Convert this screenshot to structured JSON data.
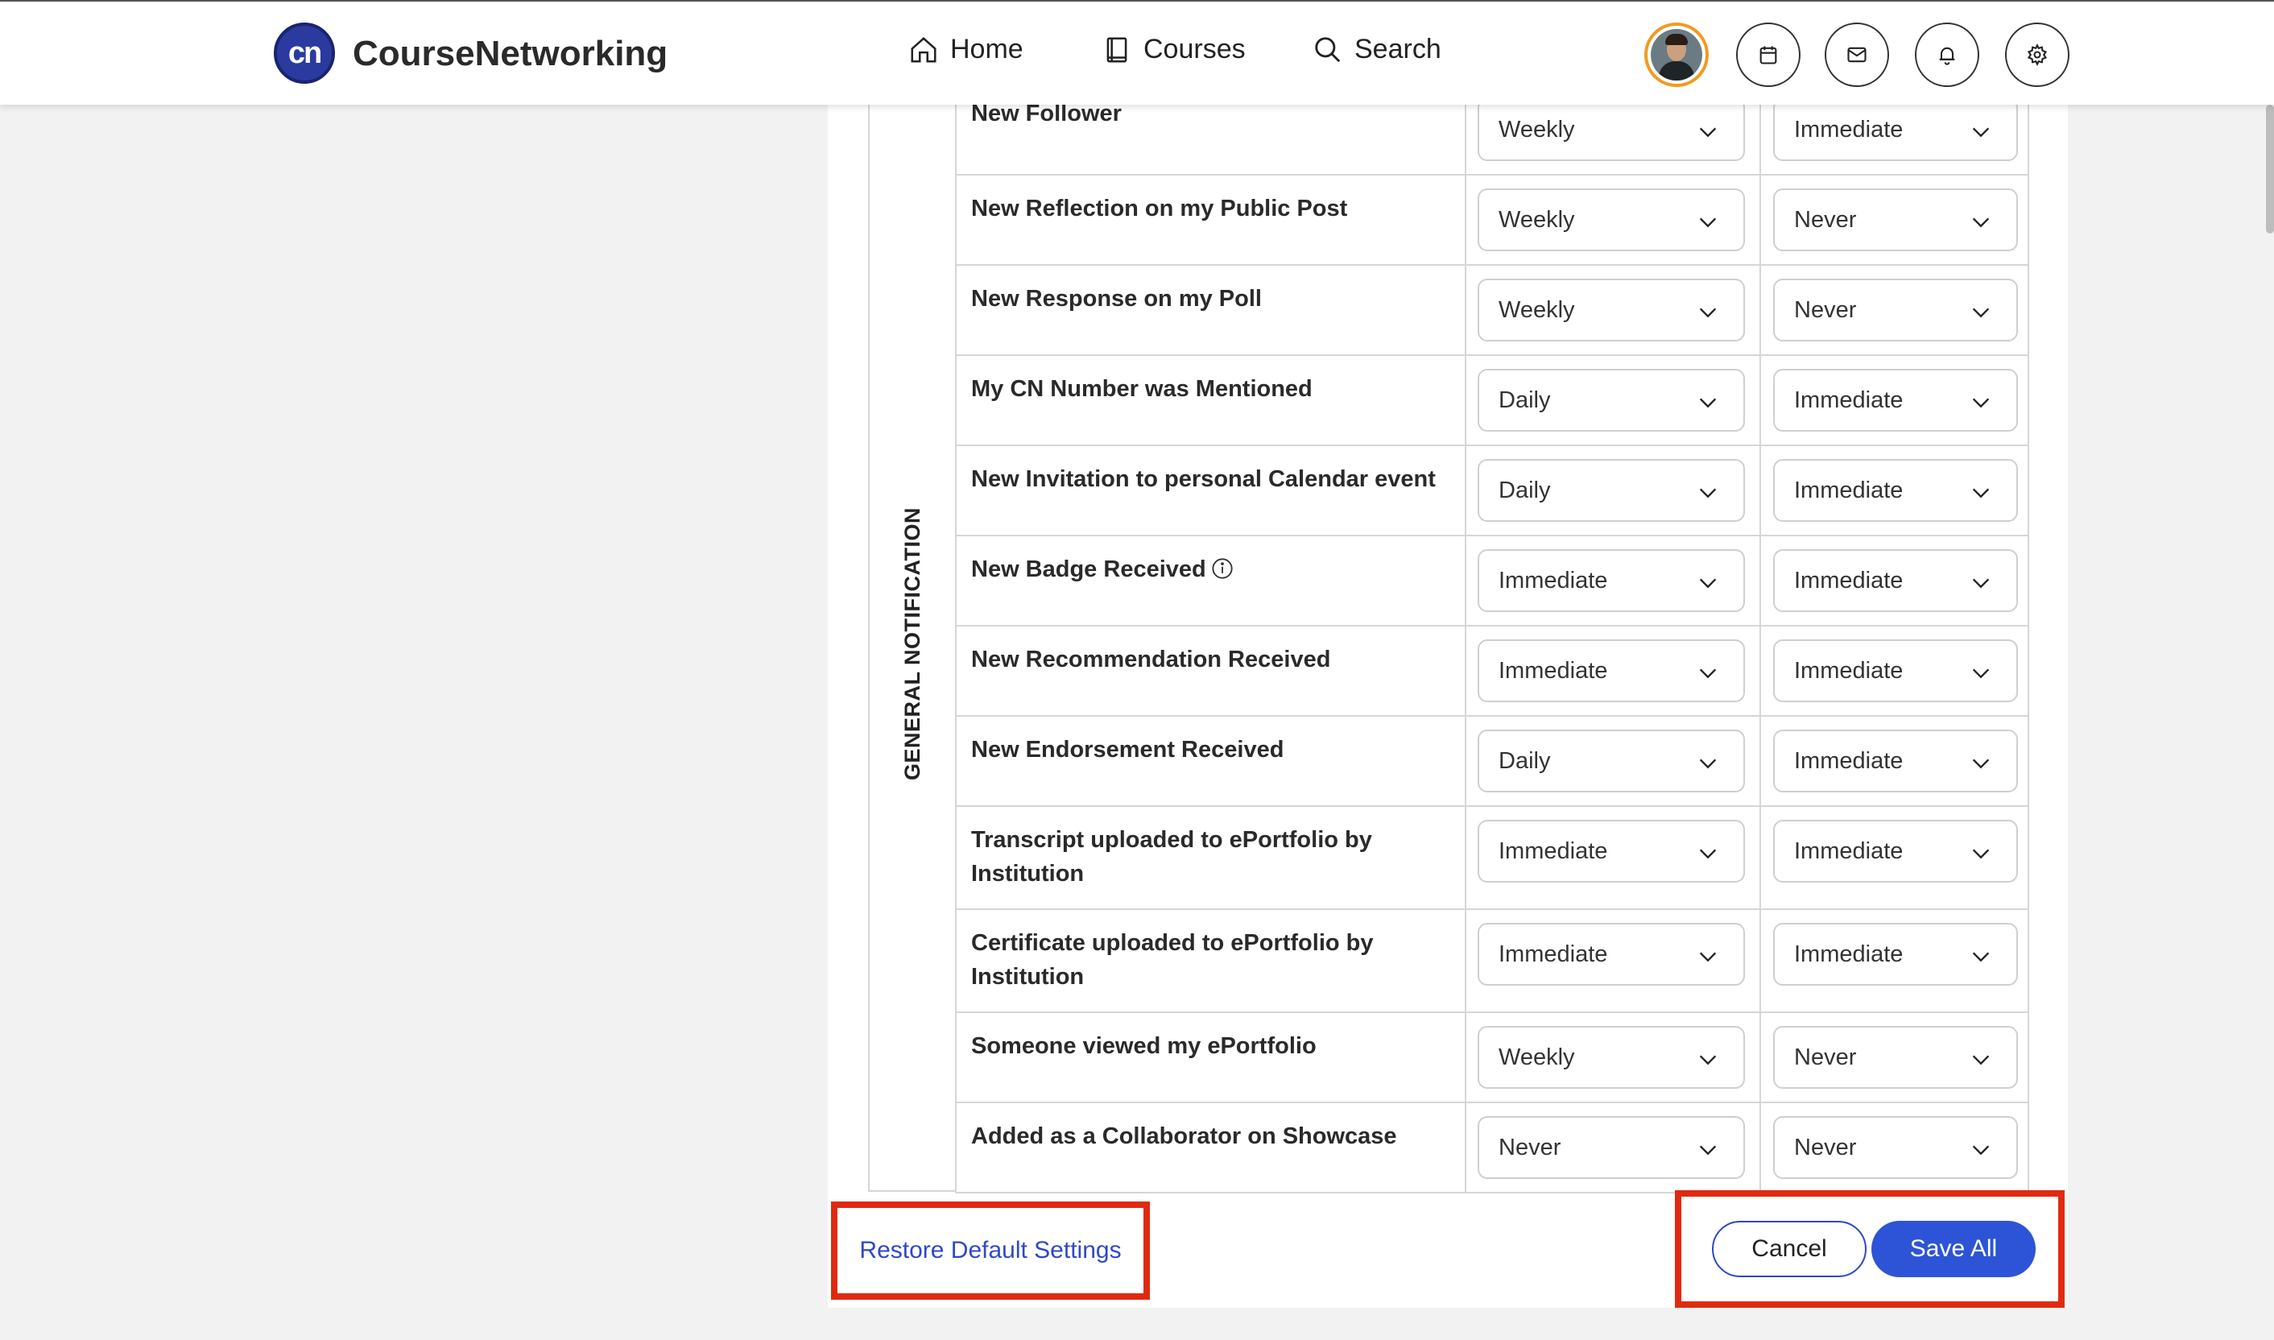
{
  "header": {
    "logo_text": "cn",
    "brand": "CourseNetworking",
    "nav": {
      "home": "Home",
      "courses": "Courses",
      "search": "Search"
    }
  },
  "section": {
    "group_label": "GENERAL NOTIFICATION"
  },
  "rows": [
    {
      "label": "New Follower",
      "email": "Weekly",
      "app": "Immediate"
    },
    {
      "label": "New Reflection on my Public Post",
      "email": "Weekly",
      "app": "Never"
    },
    {
      "label": "New Response on my Poll",
      "email": "Weekly",
      "app": "Never"
    },
    {
      "label": "My CN Number was Mentioned",
      "email": "Daily",
      "app": "Immediate"
    },
    {
      "label": "New Invitation to personal Calendar event",
      "email": "Daily",
      "app": "Immediate"
    },
    {
      "label": "New Badge Received",
      "email": "Immediate",
      "app": "Immediate"
    },
    {
      "label": "New Recommendation Received",
      "email": "Immediate",
      "app": "Immediate"
    },
    {
      "label": "New Endorsement Received",
      "email": "Daily",
      "app": "Immediate"
    },
    {
      "label": "Transcript uploaded to ePortfolio by Institution",
      "email": "Immediate",
      "app": "Immediate"
    },
    {
      "label": "Certificate uploaded to ePortfolio by Institution",
      "email": "Immediate",
      "app": "Immediate"
    },
    {
      "label": "Someone viewed my ePortfolio",
      "email": "Weekly",
      "app": "Never"
    },
    {
      "label": "Added as a Collaborator on Showcase",
      "email": "Never",
      "app": "Never"
    }
  ],
  "footer": {
    "restore": "Restore Default Settings",
    "cancel": "Cancel",
    "save": "Save All"
  },
  "colors": {
    "primary": "#2d54d6",
    "highlight": "#e02a10",
    "avatar_ring": "#f39a1e"
  }
}
